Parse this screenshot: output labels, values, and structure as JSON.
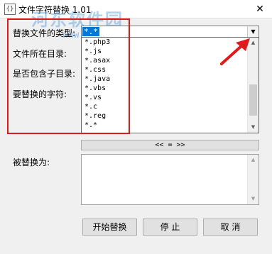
{
  "window": {
    "title": "文件字符替换 1.01",
    "icon_name": "app-icon",
    "icon_glyph": "{}",
    "close_glyph": "✕"
  },
  "watermark": {
    "text": "河东软件园",
    "url": "www.pc0359.cn"
  },
  "labels": {
    "file_type": "替换文件的类型:",
    "directory": "文件所在目录:",
    "include_subdirs": "是否包含子目录:",
    "find_text": "要替换的字符:",
    "replace_with": "被替换为:"
  },
  "file_type_combo": {
    "selected": "*.*",
    "arrow_glyph": "▼",
    "options": [
      "*.php3",
      "*.js",
      "*.asax",
      "*.css",
      "*.java",
      "*.vbs",
      "*.vs",
      "*.c",
      "*.reg",
      "*.*"
    ]
  },
  "scrollbar": {
    "up_glyph": "▲",
    "down_glyph": "▼"
  },
  "swap_button": "<< = >>",
  "buttons": {
    "start": "开始替换",
    "stop": "停  止",
    "cancel": "取  消"
  },
  "colors": {
    "selection": "#0078d7",
    "annotation_red": "#e01a1a"
  }
}
